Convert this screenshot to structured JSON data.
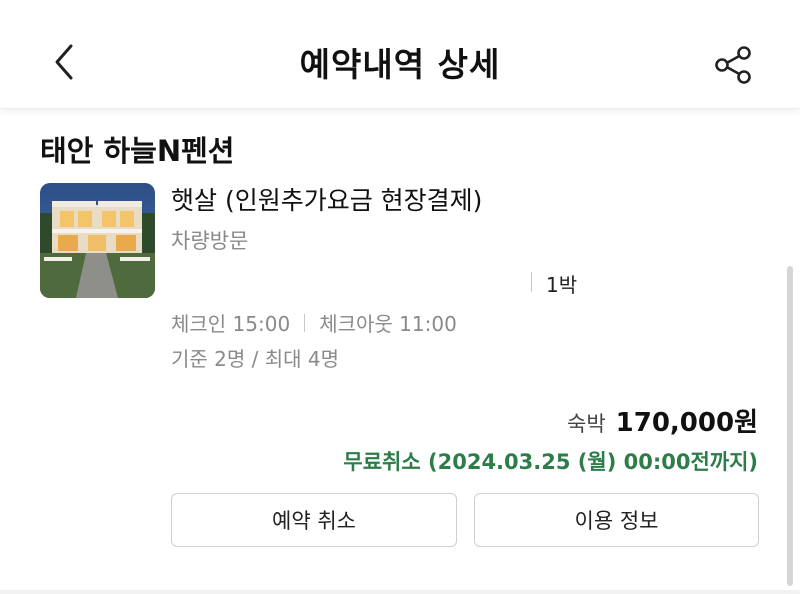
{
  "header": {
    "title": "예약내역 상세",
    "back_icon": "chevron-left-icon",
    "share_icon": "share-icon"
  },
  "property": {
    "name": "태안 하늘N펜션"
  },
  "room": {
    "name": "햇살 (인원추가요금 현장결제)",
    "visit_type": "차량방문",
    "nights": "1박",
    "checkin": "체크인 15:00",
    "checkout": "체크아웃 11:00",
    "capacity": "기준 2명 / 최대 4명"
  },
  "price": {
    "label": "숙박",
    "value": "170,000원"
  },
  "cancellation": {
    "text": "무료취소 (2024.03.25 (월) 00:00전까지)",
    "color": "#2d7d4a"
  },
  "actions": {
    "cancel_label": "예약 취소",
    "info_label": "이용 정보"
  }
}
